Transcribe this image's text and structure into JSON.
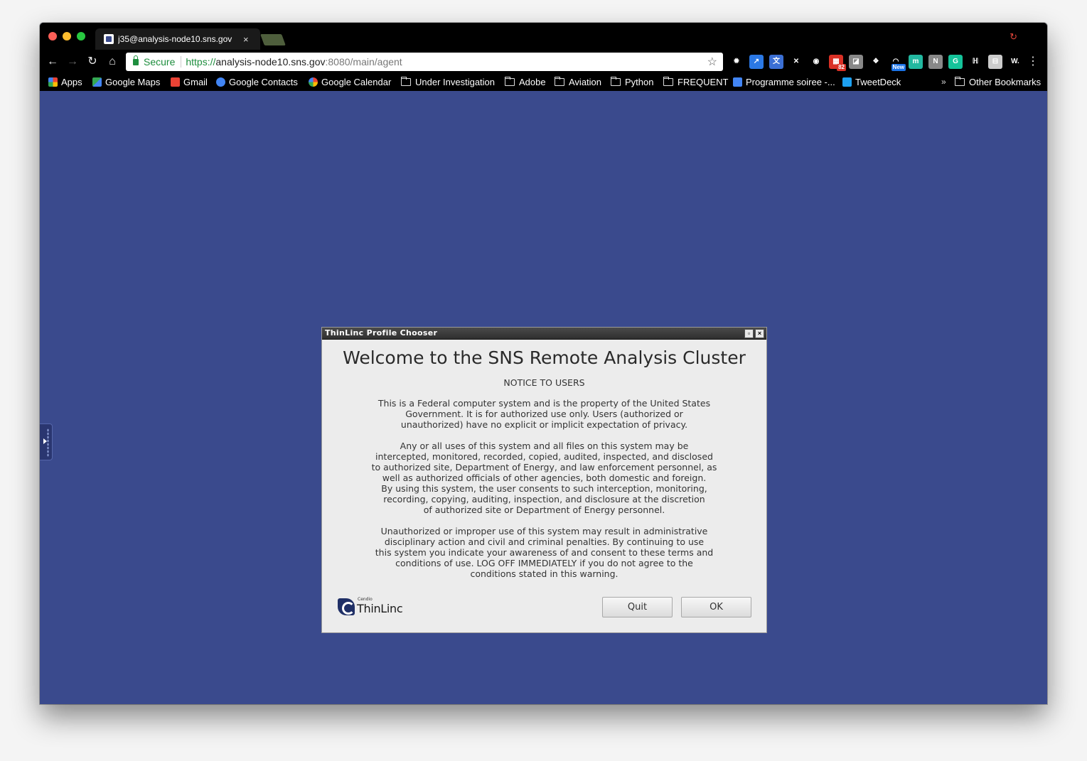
{
  "browser": {
    "tab_title": "j35@analysis-node10.sns.gov",
    "tab_close": "×",
    "secure_label": "Secure",
    "url_scheme": "https://",
    "url_host": "analysis-node10.sns.gov",
    "url_path": ":8080/main/agent",
    "icons": {
      "back": "←",
      "forward": "→",
      "reload": "↻",
      "home": "⌂",
      "star": "☆",
      "menu": "⋮",
      "sync": "↻"
    },
    "extensions": [
      {
        "name": "gear-icon",
        "glyph": "✹",
        "bg": "#000000",
        "badge": ""
      },
      {
        "name": "expand-icon",
        "glyph": "↗",
        "bg": "#2b78e4",
        "badge": ""
      },
      {
        "name": "translate-icon",
        "glyph": "文",
        "bg": "#3b6fd4",
        "badge": ""
      },
      {
        "name": "blocker-icon",
        "glyph": "✕",
        "bg": "#000000",
        "badge": ""
      },
      {
        "name": "lastpass-icon",
        "glyph": "◉",
        "bg": "#000000",
        "badge": ""
      },
      {
        "name": "calendar-badge-icon",
        "glyph": "▦",
        "bg": "#d93025",
        "badge": "82"
      },
      {
        "name": "note-icon",
        "glyph": "◪",
        "bg": "#888888",
        "badge": ""
      },
      {
        "name": "dropbox-icon",
        "glyph": "❖",
        "bg": "#000000",
        "badge": ""
      },
      {
        "name": "rainbow-icon",
        "glyph": "◠",
        "bg": "#000000",
        "badge": "New"
      },
      {
        "name": "mercury-icon",
        "glyph": "m",
        "bg": "#22b8a0",
        "badge": ""
      },
      {
        "name": "reader-icon",
        "glyph": "N",
        "bg": "#888888",
        "badge": ""
      },
      {
        "name": "grammarly-icon",
        "glyph": "G",
        "bg": "#15c39a",
        "badge": ""
      },
      {
        "name": "clipper-icon",
        "glyph": "ℍ",
        "bg": "#000000",
        "badge": ""
      },
      {
        "name": "box-icon",
        "glyph": "⊟",
        "bg": "#cccccc",
        "badge": ""
      },
      {
        "name": "w-icon",
        "glyph": "W.",
        "bg": "#000000",
        "badge": ""
      }
    ],
    "bookmarks": [
      {
        "label": "Apps",
        "icon": "apps-grid-icon",
        "type": "apps"
      },
      {
        "label": "Google Maps",
        "icon": "maps-icon",
        "type": "maps"
      },
      {
        "label": "Gmail",
        "icon": "gmail-icon",
        "type": "gmail"
      },
      {
        "label": "Google Contacts",
        "icon": "contacts-icon",
        "type": "contacts"
      },
      {
        "label": "Google Calendar",
        "icon": "google-icon",
        "type": "google"
      },
      {
        "label": "Under Investigation",
        "icon": "folder-icon",
        "type": "folder"
      },
      {
        "label": "Adobe",
        "icon": "folder-icon",
        "type": "folder"
      },
      {
        "label": "Aviation",
        "icon": "folder-icon",
        "type": "folder"
      },
      {
        "label": "Python",
        "icon": "folder-icon",
        "type": "folder"
      },
      {
        "label": "FREQUENT",
        "icon": "folder-icon",
        "type": "folder"
      },
      {
        "label": "Programme soiree -...",
        "icon": "doc-icon",
        "type": "doc"
      },
      {
        "label": "TweetDeck",
        "icon": "tweetdeck-icon",
        "type": "tweetdeck"
      }
    ],
    "bookmarks_overflow": "»",
    "other_bookmarks": "Other Bookmarks"
  },
  "dialog": {
    "window_title": "ThinLinc Profile Chooser",
    "maximize_glyph": "▫",
    "close_glyph": "×",
    "heading": "Welcome to the SNS Remote Analysis Cluster",
    "notice_heading": "NOTICE TO USERS",
    "paragraph_1": "This is a Federal computer system and is the property of the United States\nGovernment.  It is for authorized use only.  Users (authorized or\nunauthorized) have no explicit or implicit expectation of privacy.",
    "paragraph_2": "Any or all uses of this system and all files on this system may be\nintercepted, monitored, recorded, copied, audited, inspected, and disclosed\nto authorized site, Department of Energy, and law enforcement personnel, as\nwell as authorized officials of other agencies, both domestic and foreign.\nBy using this system, the user consents to such interception, monitoring,\nrecording, copying, auditing, inspection, and disclosure at the discretion\nof authorized site or Department of Energy personnel.",
    "paragraph_3": "Unauthorized or improper use of this system may result in administrative\ndisciplinary action and civil and criminal penalties.  By continuing to use\nthis system you indicate your awareness of and consent to these terms and\nconditions of use.  LOG OFF IMMEDIATELY if you do not agree to the\nconditions stated in this warning.",
    "logo_small": "Cendio",
    "logo_text": "ThinLinc",
    "logo_mark": "®",
    "quit_label": "Quit",
    "ok_label": "OK"
  },
  "colors": {
    "desktop_bg": "#3a4a8d",
    "browser_chrome": "#000000",
    "secure_green": "#1e8e3e"
  }
}
